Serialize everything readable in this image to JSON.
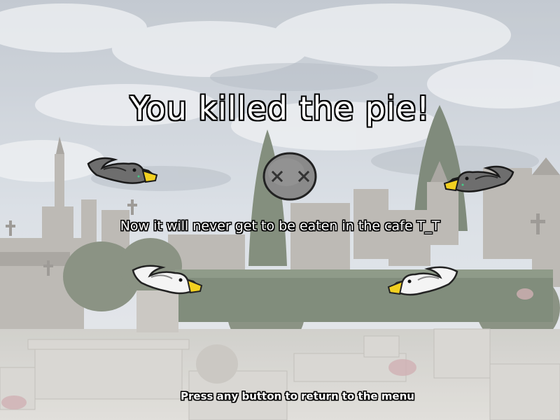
{
  "game_over": {
    "title": "You killed the pie!",
    "message": "Now it will never get to be eaten in the cafe T_T",
    "prompt": "Press any button to return to the menu"
  },
  "sprites": {
    "dead_pie": "dead-pie-icon",
    "crows": [
      "grey-crow-icon",
      "grey-crow-icon"
    ],
    "doves": [
      "white-dove-icon",
      "white-dove-icon"
    ]
  },
  "colors": {
    "sky": "#c9d0d8",
    "text": "#ffffff",
    "outline": "#000000",
    "beak": "#f2d020",
    "pie": "#8a8a8a",
    "crow": "#6e6e6e",
    "dove": "#f4f4f4"
  }
}
